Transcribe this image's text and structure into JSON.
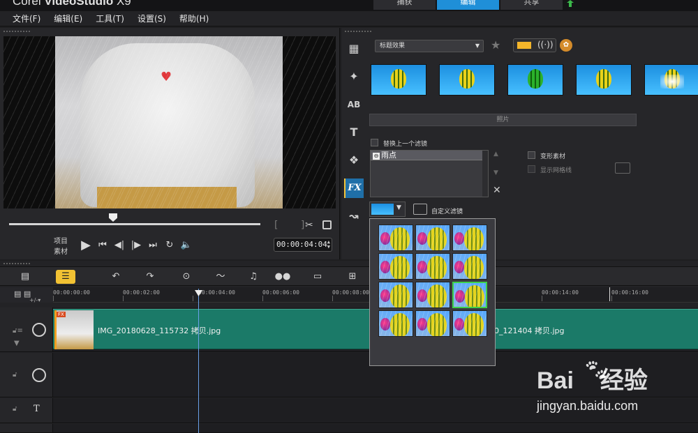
{
  "app": {
    "title_prefix": "Corel",
    "title_bold": "VideoStudio",
    "title_suffix": "X9"
  },
  "mode_tabs": [
    {
      "label": "捕获",
      "active": false
    },
    {
      "label": "编辑",
      "active": true
    },
    {
      "label": "共享",
      "active": false
    }
  ],
  "menu": [
    "文件(F)",
    "编辑(E)",
    "工具(T)",
    "设置(S)",
    "帮助(H)"
  ],
  "player": {
    "project_label": "项目",
    "clip_label": "素材",
    "timecode": "00:00:04:04",
    "scrub_position": 0.41,
    "icons": [
      "play-icon",
      "home-icon",
      "prev-frame-icon",
      "next-frame-icon",
      "end-icon",
      "repeat-icon",
      "volume-icon",
      "cut-icon",
      "copy-icon"
    ]
  },
  "library": {
    "category": "标题效果",
    "caption": "照片",
    "replace_filter_label": "替换上一个滤镜",
    "filters": [
      "雨点"
    ],
    "deform_label": "变形素材",
    "show_grid_label": "显示网格线",
    "custom_filter_label": "自定义滤镜",
    "side_tabs": [
      "media-icon",
      "instant-project-icon",
      "transition-icon",
      "title-icon",
      "graphic-icon",
      "filter-icon",
      "path-icon"
    ],
    "thumbnails": [
      "balloon-thumb-1",
      "balloon-thumb-2",
      "balloon-thumb-3",
      "balloon-thumb-4",
      "balloon-thumb-5"
    ]
  },
  "preset_popup": {
    "rows": 4,
    "cols": 3,
    "selected_index": 8
  },
  "timeline": {
    "ruler": [
      "00:00:00:00",
      "00:00:02:00",
      "00:00:04:00",
      "00:00:06:00",
      "00:00:08:00",
      "00:00:14:00",
      "00:00:16:00"
    ],
    "clip_name_1": "IMG_20180628_115732 拷贝.jpg",
    "clip_name_2": "0_121404 拷贝.jpg"
  },
  "watermark": {
    "brand_a": "Bai",
    "brand_b": "经验",
    "url": "jingyan.baidu.com"
  }
}
